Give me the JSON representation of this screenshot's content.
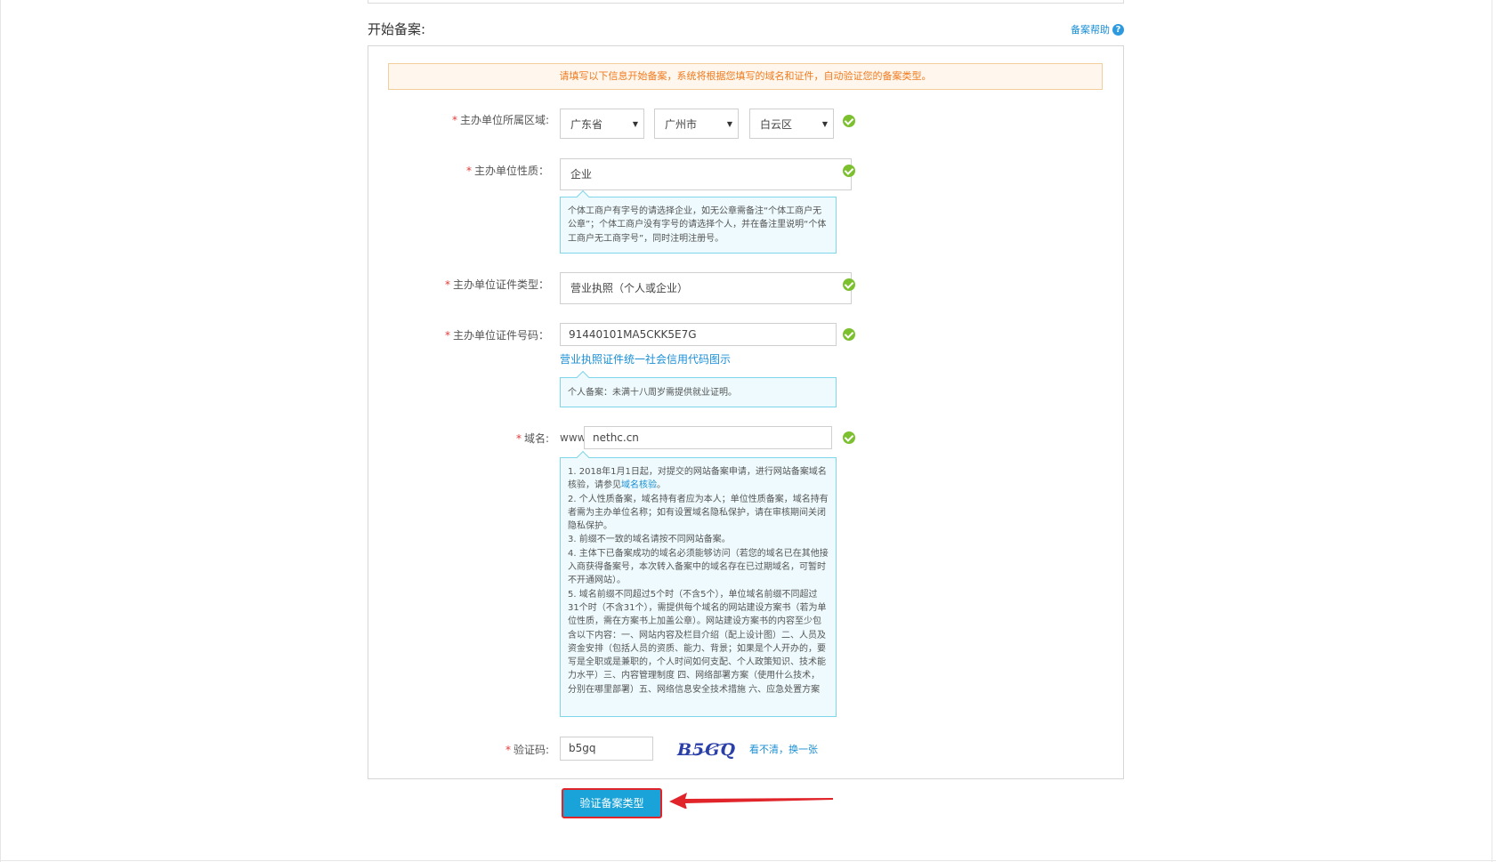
{
  "section": {
    "title": "开始备案:",
    "help_label": "备案帮助",
    "help_icon": "question-circle-icon"
  },
  "notice": "请填写以下信息开始备案，系统将根据您填写的域名和证件，自动验证您的备案类型。",
  "form": {
    "required_mark": "*",
    "region": {
      "label": "主办单位所属区域:",
      "province": "广东省",
      "city": "广州市",
      "district": "白云区"
    },
    "nature": {
      "label": "主办单位性质：",
      "value": "企业",
      "tip": "个体工商户有字号的请选择企业，如无公章需备注“个体工商户无公章”；个体工商户没有字号的请选择个人，并在备注里说明“个体工商户无工商字号”，同时注明注册号。"
    },
    "cert_type": {
      "label": "主办单位证件类型：",
      "value": "营业执照（个人或企业）"
    },
    "cert_number": {
      "label": "主办单位证件号码：",
      "value": "91440101MA5CKK5E7G",
      "link": "营业执照证件统一社会信用代码图示",
      "tip": "个人备案：未满十八周岁需提供就业证明。"
    },
    "domain": {
      "label": "域名:",
      "prefix": "www.",
      "value": "nethc.cn",
      "tip_1_before": "1. 2018年1月1日起，对提交的网站备案申请，进行网站备案域名核验，请参见",
      "tip_1_link": "域名核验",
      "tip_1_after": "。",
      "tip_2": "2. 个人性质备案，域名持有者应为本人；单位性质备案，域名持有者需为主办单位名称；如有设置域名隐私保护，请在审核期间关闭隐私保护。",
      "tip_3": "3. 前缀不一致的域名请按不同网站备案。",
      "tip_4": "4. 主体下已备案成功的域名必须能够访问（若您的域名已在其他接入商获得备案号，本次转入备案中的域名存在已过期域名，可暂时不开通网站）。",
      "tip_5": "5. 域名前缀不同超过5个时（不含5个），单位域名前缀不同超过31个时（不含31个），需提供每个域名的网站建设方案书（若为单位性质，需在方案书上加盖公章）。网站建设方案书的内容至少包含以下内容：一、网站内容及栏目介绍（配上设计图）二、人员及资金安排（包括人员的资质、能力、背景；如果是个人开办的，要写是全职或是兼职的，个人时间如何支配、个人政策知识、技术能力水平）三、内容管理制度 四、网络部署方案（使用什么技术，分别在哪里部署）五、网络信息安全技术措施 六、应急处置方案"
    },
    "captcha": {
      "label": "验证码:",
      "value": "b5gq",
      "image_text": "B5GQ",
      "refresh_link": "看不清，换一张"
    }
  },
  "submit_label": "验证备案类型",
  "colors": {
    "accent": "#1aa3d8",
    "link": "#1a8fd5",
    "success": "#7cc030",
    "required": "#e13a3a",
    "notice_text": "#f07a1e",
    "highlight": "#e0242a"
  }
}
